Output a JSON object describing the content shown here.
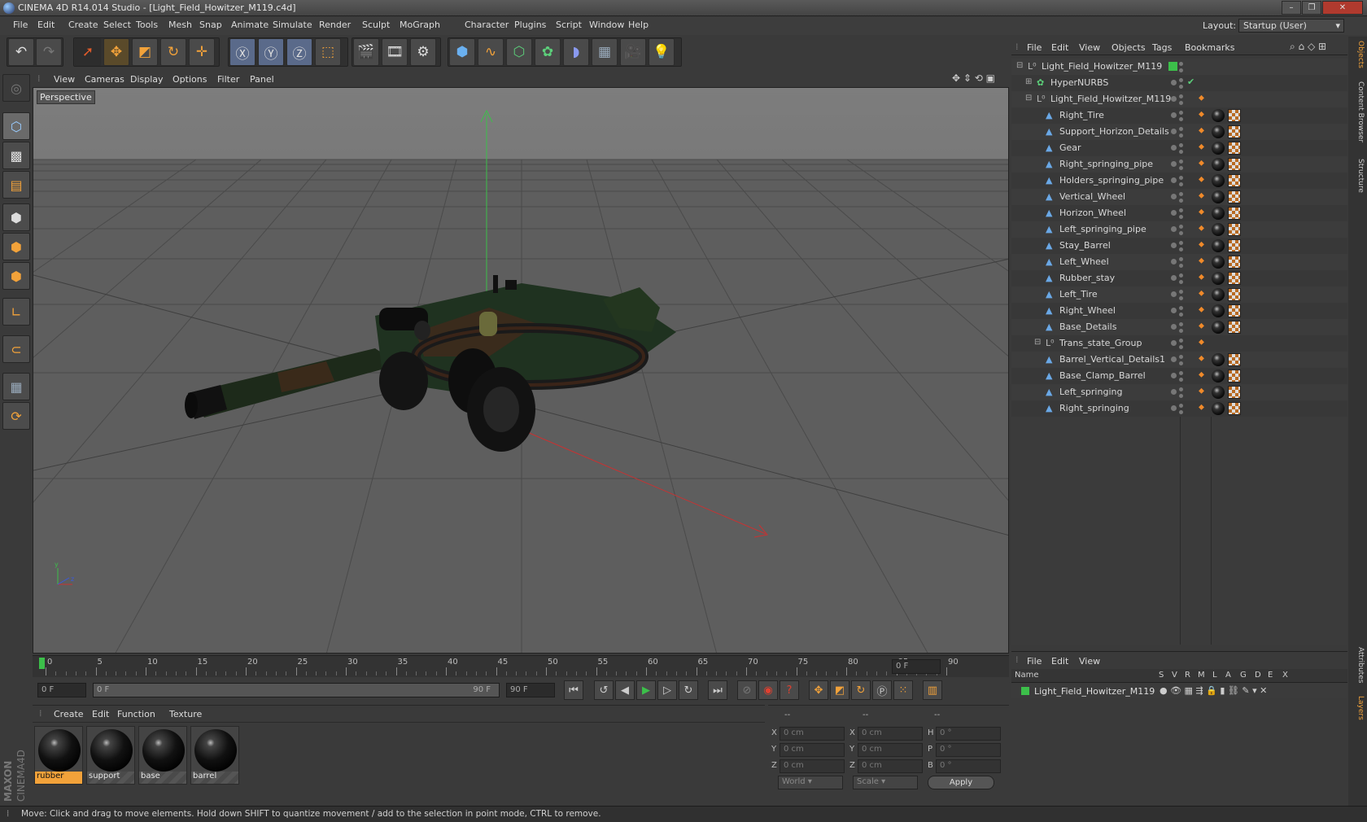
{
  "window": {
    "title": "CINEMA 4D R14.014 Studio - [Light_Field_Howitzer_M119.c4d]",
    "layout_label": "Layout:",
    "layout_value": "Startup (User)"
  },
  "menus": [
    "File",
    "Edit",
    "Create",
    "Select",
    "Tools",
    "Mesh",
    "Snap",
    "Animate",
    "Simulate",
    "Render",
    "Sculpt",
    "MoGraph",
    "Character",
    "Plugins",
    "Script",
    "Window",
    "Help"
  ],
  "viewport": {
    "menu": [
      "View",
      "Cameras",
      "Display",
      "Options",
      "Filter",
      "Panel"
    ],
    "label": "Perspective"
  },
  "timeline": {
    "ticks": [
      "0",
      "5",
      "10",
      "15",
      "20",
      "25",
      "30",
      "35",
      "40",
      "45",
      "50",
      "55",
      "60",
      "65",
      "70",
      "75",
      "80",
      "85",
      "90"
    ],
    "end_field": "0 F"
  },
  "transport": {
    "start": "0 F",
    "slider_start": "0 F",
    "slider_end": "90 F",
    "end": "90 F"
  },
  "materials": {
    "menu": [
      "Create",
      "Edit",
      "Function",
      "Texture"
    ],
    "items": [
      "rubber",
      "support",
      "base",
      "barrel"
    ]
  },
  "coords": {
    "header": [
      "--",
      "--",
      "--"
    ],
    "rows": [
      {
        "a": "X",
        "av": "0 cm",
        "b": "X",
        "bv": "0 cm",
        "c": "H",
        "cv": "0 °"
      },
      {
        "a": "Y",
        "av": "0 cm",
        "b": "Y",
        "bv": "0 cm",
        "c": "P",
        "cv": "0 °"
      },
      {
        "a": "Z",
        "av": "0 cm",
        "b": "Z",
        "bv": "0 cm",
        "c": "B",
        "cv": "0 °"
      }
    ],
    "world": "World",
    "scale": "Scale",
    "apply": "Apply"
  },
  "objects": {
    "menu": [
      "File",
      "Edit",
      "View",
      "Objects",
      "Tags",
      "Bookmarks"
    ],
    "items": [
      {
        "name": "Light_Field_Howitzer_M119",
        "level": 0,
        "kind": "null"
      },
      {
        "name": "HyperNURBS",
        "level": 1,
        "kind": "nurbs"
      },
      {
        "name": "Light_Field_Howitzer_M119",
        "level": 1,
        "kind": "null"
      },
      {
        "name": "Right_Tire",
        "level": 2,
        "kind": "poly"
      },
      {
        "name": "Support_Horizon_Details",
        "level": 2,
        "kind": "poly"
      },
      {
        "name": "Gear",
        "level": 2,
        "kind": "poly"
      },
      {
        "name": "Right_springing_pipe",
        "level": 2,
        "kind": "poly"
      },
      {
        "name": "Holders_springing_pipe",
        "level": 2,
        "kind": "poly"
      },
      {
        "name": "Vertical_Wheel",
        "level": 2,
        "kind": "poly"
      },
      {
        "name": "Horizon_Wheel",
        "level": 2,
        "kind": "poly"
      },
      {
        "name": "Left_springing_pipe",
        "level": 2,
        "kind": "poly"
      },
      {
        "name": "Stay_Barrel",
        "level": 2,
        "kind": "poly"
      },
      {
        "name": "Left_Wheel",
        "level": 2,
        "kind": "poly"
      },
      {
        "name": "Rubber_stay",
        "level": 2,
        "kind": "poly"
      },
      {
        "name": "Left_Tire",
        "level": 2,
        "kind": "poly"
      },
      {
        "name": "Right_Wheel",
        "level": 2,
        "kind": "poly"
      },
      {
        "name": "Base_Details",
        "level": 2,
        "kind": "poly"
      },
      {
        "name": "Trans_state_Group",
        "level": 2,
        "kind": "null"
      },
      {
        "name": "Barrel_Vertical_Details1",
        "level": 2,
        "kind": "poly"
      },
      {
        "name": "Base_Clamp_Barrel",
        "level": 2,
        "kind": "poly"
      },
      {
        "name": "Left_springing",
        "level": 2,
        "kind": "poly"
      },
      {
        "name": "Right_springing",
        "level": 2,
        "kind": "poly"
      }
    ]
  },
  "layers": {
    "menu": [
      "File",
      "Edit",
      "View"
    ],
    "cols": [
      "Name",
      "S",
      "V",
      "R",
      "M",
      "L",
      "A",
      "G",
      "D",
      "E",
      "X"
    ],
    "row": "Light_Field_Howitzer_M119"
  },
  "side_tabs": [
    "Objects",
    "Content Browser",
    "Structure",
    "Attributes",
    "Layers"
  ],
  "status": "Move: Click and drag to move elements. Hold down SHIFT to quantize movement / add to the selection in point mode, CTRL to remove.",
  "branding": {
    "line1": "MAXON",
    "line2": "CINEMA4D"
  }
}
